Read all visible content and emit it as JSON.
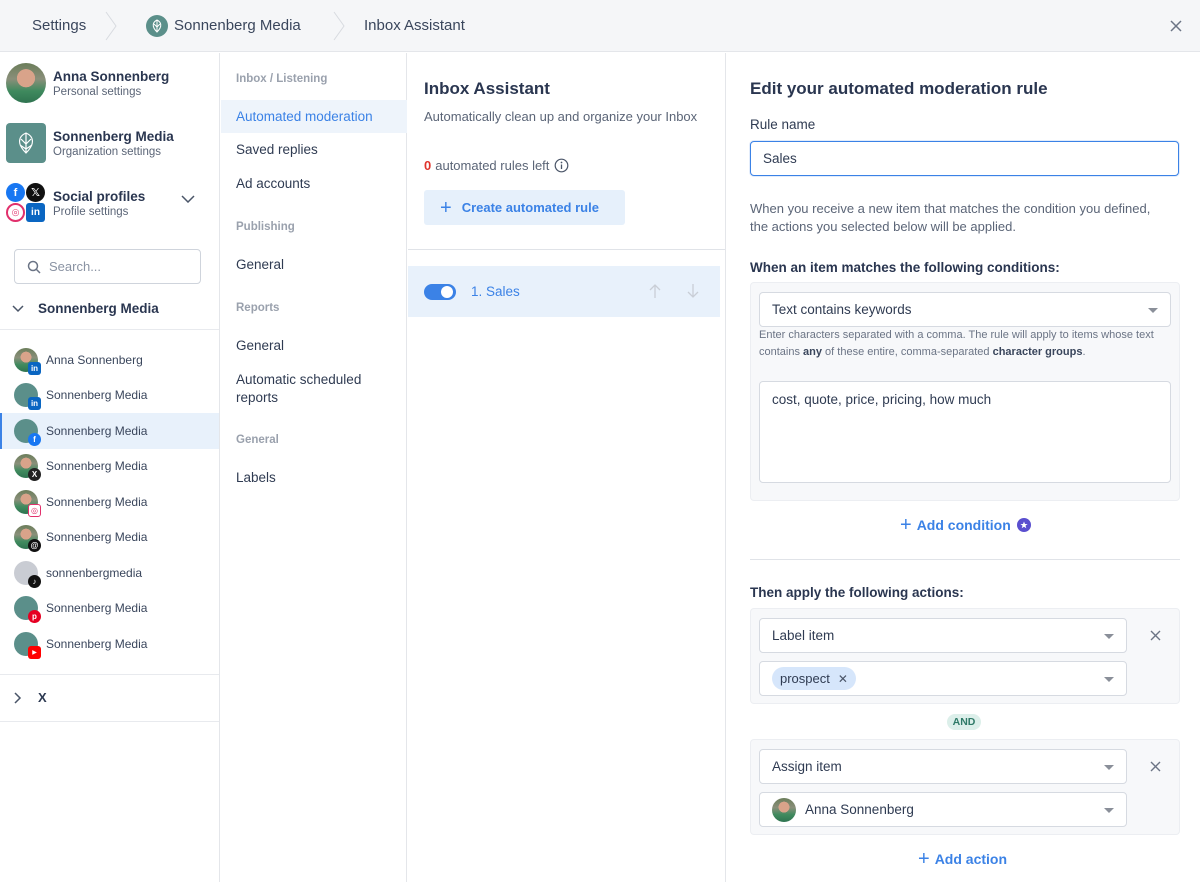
{
  "header": {
    "breadcrumbs": [
      "Settings",
      "Sonnenberg Media",
      "Inbox Assistant"
    ],
    "close_icon": "close-icon"
  },
  "sidebar": {
    "accounts": [
      {
        "title": "Anna Sonnenberg",
        "subtitle": "Personal settings",
        "icon": "user-avatar"
      },
      {
        "title": "Sonnenberg Media",
        "subtitle": "Organization settings",
        "icon": "org-logo"
      },
      {
        "title": "Social profiles",
        "subtitle": "Profile settings",
        "icon": "social-cluster"
      }
    ],
    "search_placeholder": "Search...",
    "group": "Sonnenberg Media",
    "profiles": [
      {
        "name": "Anna Sonnenberg",
        "network": "linkedin",
        "avatar": "photo"
      },
      {
        "name": "Sonnenberg Media",
        "network": "linkedin",
        "avatar": "org"
      },
      {
        "name": "Sonnenberg Media",
        "network": "facebook",
        "avatar": "org",
        "active": true
      },
      {
        "name": "Sonnenberg Media",
        "network": "x",
        "avatar": "photo"
      },
      {
        "name": "Sonnenberg Media",
        "network": "instagram",
        "avatar": "photo"
      },
      {
        "name": "Sonnenberg Media",
        "network": "threads",
        "avatar": "photo"
      },
      {
        "name": "sonnenbergmedia",
        "network": "tiktok",
        "avatar": "placeholder"
      },
      {
        "name": "Sonnenberg Media",
        "network": "pinterest",
        "avatar": "org"
      },
      {
        "name": "Sonnenberg Media",
        "network": "youtube",
        "avatar": "org"
      }
    ],
    "collapsed_group": "X"
  },
  "nav": {
    "sections": [
      {
        "title": "Inbox / Listening",
        "items": [
          "Automated moderation",
          "Saved replies",
          "Ad accounts"
        ]
      },
      {
        "title": "Publishing",
        "items": [
          "General"
        ]
      },
      {
        "title": "Reports",
        "items": [
          "General",
          "Automatic scheduled reports"
        ]
      },
      {
        "title": "General",
        "items": [
          "Labels"
        ]
      }
    ],
    "active": "Automated moderation"
  },
  "rules": {
    "title": "Inbox Assistant",
    "description": "Automatically clean up and organize your Inbox",
    "rules_left_count": "0",
    "rules_left_text": "automated rules left",
    "create_button": "Create automated rule",
    "list": [
      {
        "label": "1. Sales",
        "enabled": true
      }
    ]
  },
  "editor": {
    "title": "Edit your automated moderation rule",
    "rule_name_label": "Rule name",
    "rule_name_value": "Sales",
    "description": "When you receive a new item that matches the condition you defined, the actions you selected below will be applied.",
    "conditions_heading": "When an item matches the following conditions:",
    "condition_type": "Text contains keywords",
    "hint_part1": "Enter characters separated with a comma. The rule will apply to items whose text contains ",
    "hint_bold1": "any",
    "hint_part2": " of these entire, comma-separated ",
    "hint_bold2": "character groups",
    "hint_part3": ".",
    "keywords": "cost, quote, price, pricing, how much",
    "add_condition": "Add condition",
    "actions_heading": "Then apply the following actions:",
    "actions": [
      {
        "type": "Label item",
        "value_chip": "prospect"
      },
      {
        "type": "Assign item",
        "value": "Anna Sonnenberg"
      }
    ],
    "and_label": "AND",
    "add_action": "Add action"
  },
  "colors": {
    "accent": "#3b82e6",
    "brand_teal": "#5b8f8a",
    "danger": "#e0342c",
    "premium": "#5a4fcf"
  }
}
